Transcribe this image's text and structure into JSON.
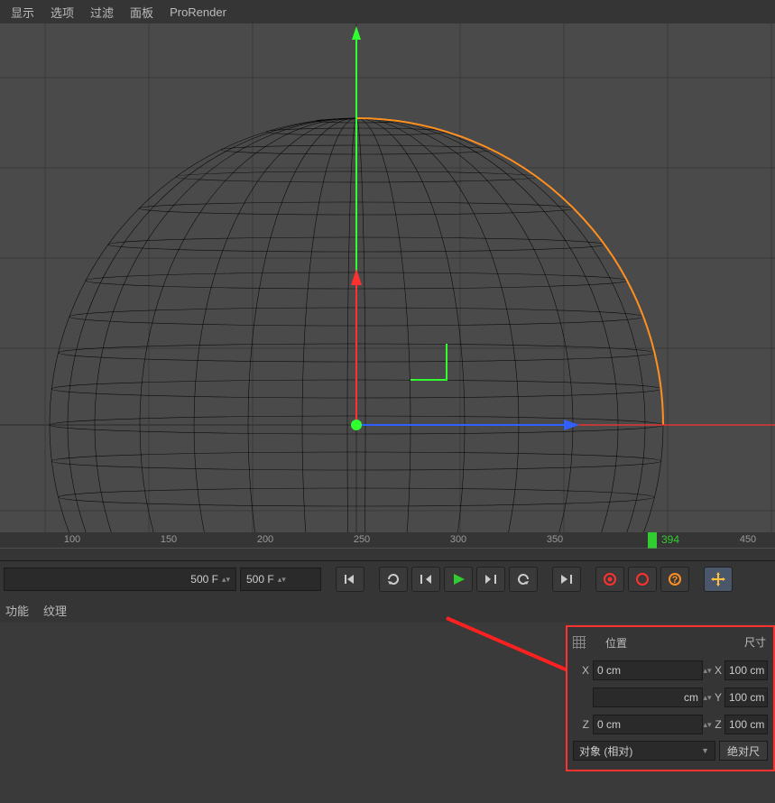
{
  "menubar": {
    "items": [
      "显示",
      "选项",
      "过滤",
      "面板",
      "ProRender"
    ]
  },
  "timeline": {
    "labels": [
      100,
      150,
      200,
      250,
      300,
      350,
      450
    ],
    "current": 394
  },
  "transport": {
    "frame_end": "500 F",
    "frame_field": "500 F"
  },
  "tabs": {
    "items": [
      "功能",
      "纹理"
    ]
  },
  "coords": {
    "pos_title": "位置",
    "size_title": "尺寸",
    "x_label": "X",
    "y_label": "Y",
    "z_label": "Z",
    "x_val": "0 cm",
    "y_val": "cm",
    "z_val": "0 cm",
    "size_x": "100 cm",
    "size_y": "100 cm",
    "size_z": "100 cm",
    "mode_label": "对象 (相对)",
    "abs_label": "绝对尺"
  }
}
